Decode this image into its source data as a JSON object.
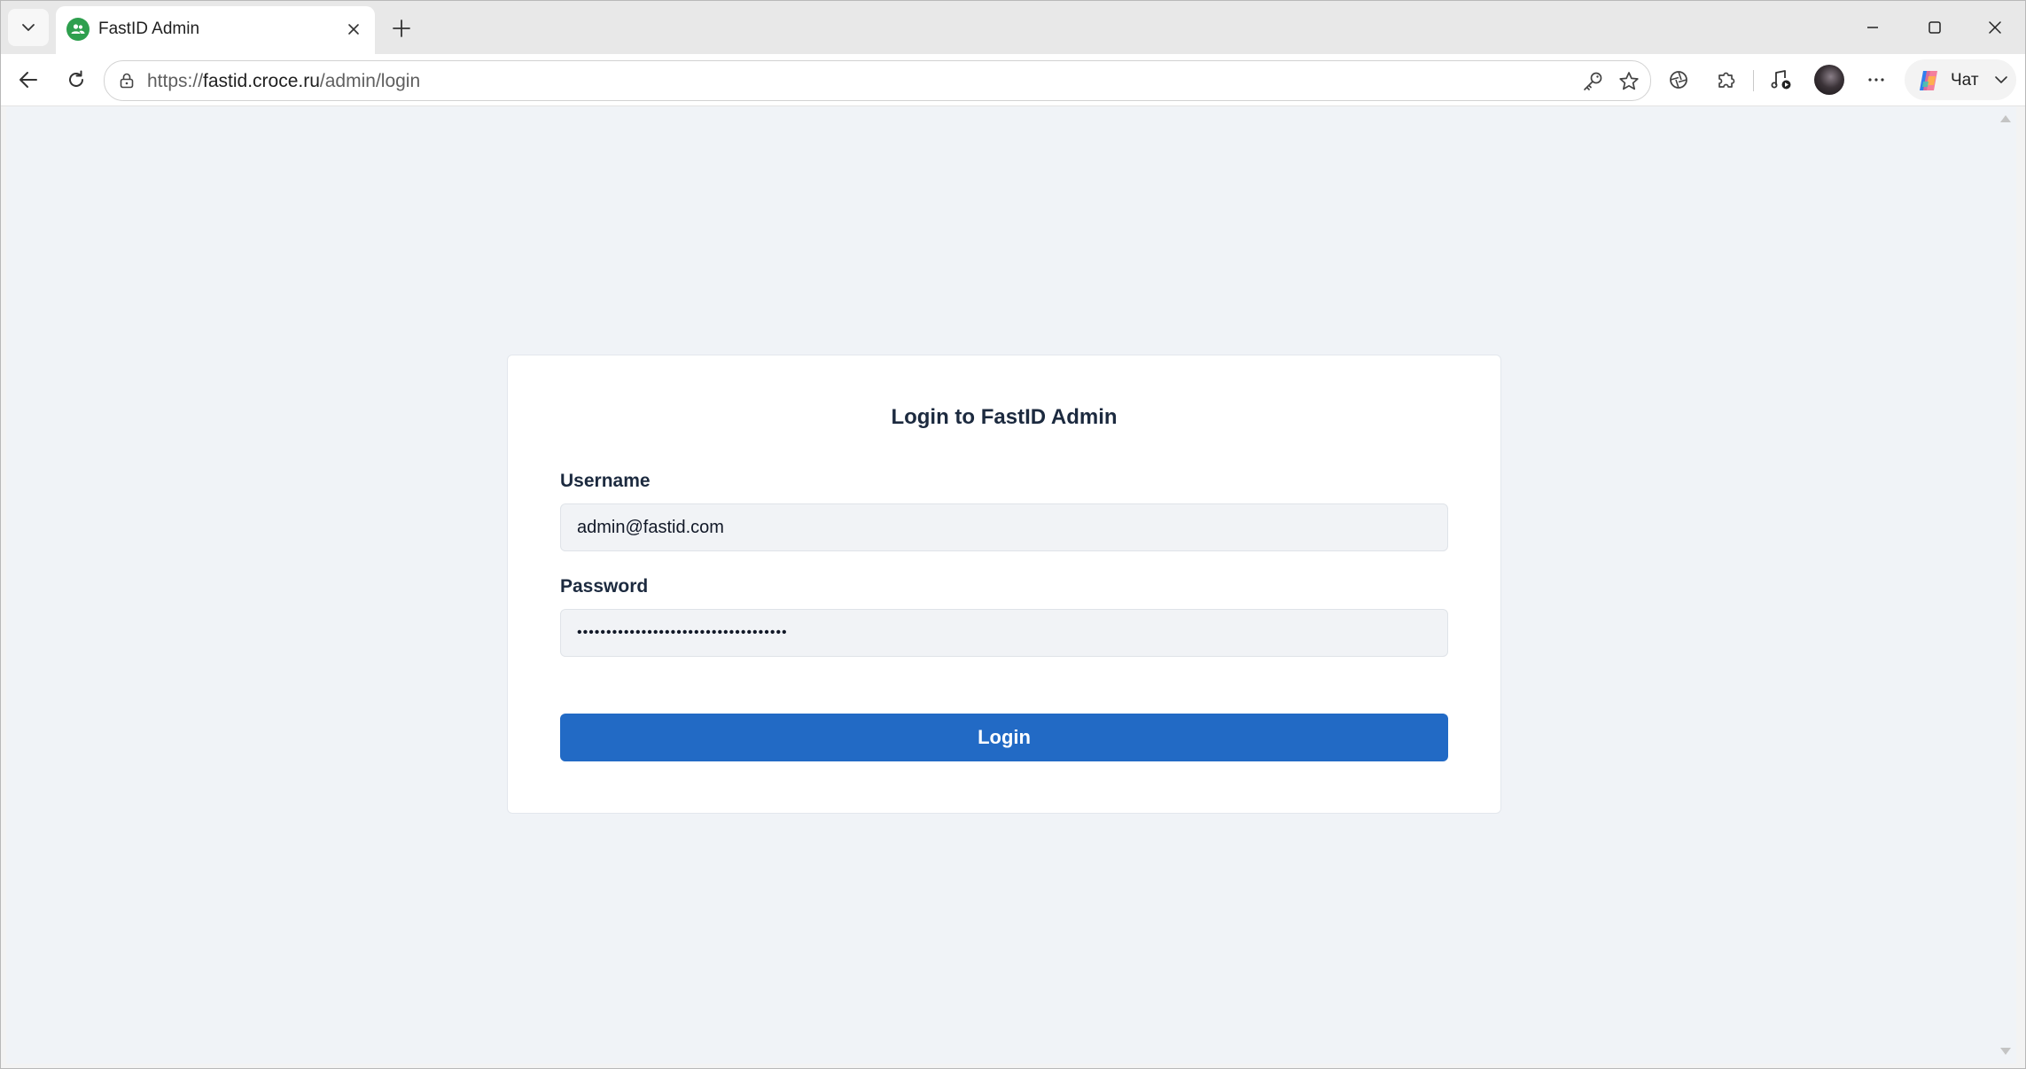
{
  "browser": {
    "tab": {
      "title": "FastID Admin"
    },
    "address_bar": {
      "scheme": "https://",
      "host": "fastid.croce.ru",
      "path": "/admin/login"
    },
    "chat_button": {
      "label": "Чат"
    },
    "icons": {
      "tab_list": "chevron-down-icon",
      "favicon": "people-icon",
      "tab_close": "close-icon",
      "new_tab": "plus-icon",
      "minimize": "minimize-icon",
      "maximize": "maximize-icon",
      "close_window": "close-icon",
      "back": "back-arrow-icon",
      "reload": "reload-icon",
      "site_info": "lock-icon",
      "password": "key-icon",
      "favorite": "star-icon",
      "aperture": "aperture-icon",
      "extensions": "puzzle-icon",
      "media": "music-note-icon",
      "more": "more-dots-icon",
      "copilot": "copilot-logo-icon"
    }
  },
  "page": {
    "background": "#f0f3f7",
    "login_card": {
      "title": "Login to FastID Admin",
      "username": {
        "label": "Username",
        "value": "admin@fastid.com"
      },
      "password": {
        "label": "Password",
        "value": "••••••••••••••••••••••••••••••••••••"
      },
      "submit": {
        "label": "Login",
        "color": "#226ac5"
      }
    }
  }
}
